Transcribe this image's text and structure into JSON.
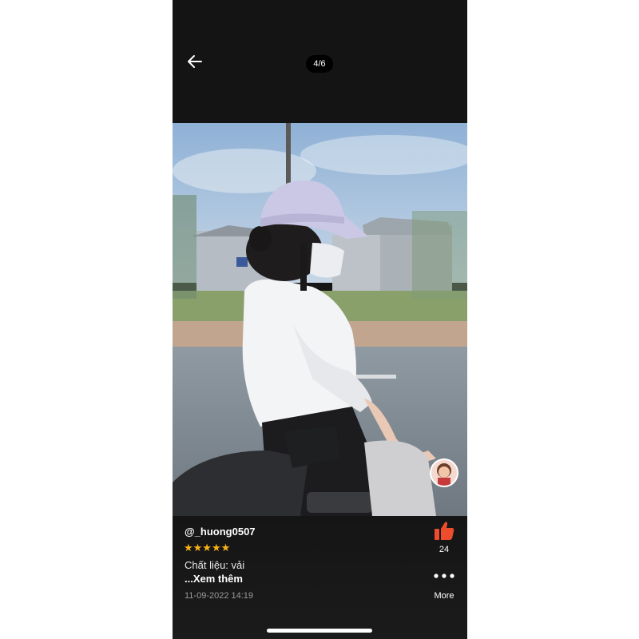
{
  "header": {
    "counter": "4/6"
  },
  "icons": {
    "back": "arrow-left-icon",
    "like": "thumbs-up-icon",
    "more": "more-dots-icon"
  },
  "review": {
    "username": "@_huong0507",
    "rating": 5,
    "stars": "★★★★★",
    "text": "Chất liệu: vải",
    "expand_label": "...Xem thêm",
    "date": "11-09-2022 14:19",
    "likes": "24",
    "more_label": "More"
  },
  "colors": {
    "star": "#f7b21a",
    "like": "#ee4d2d",
    "background": "#161616"
  }
}
